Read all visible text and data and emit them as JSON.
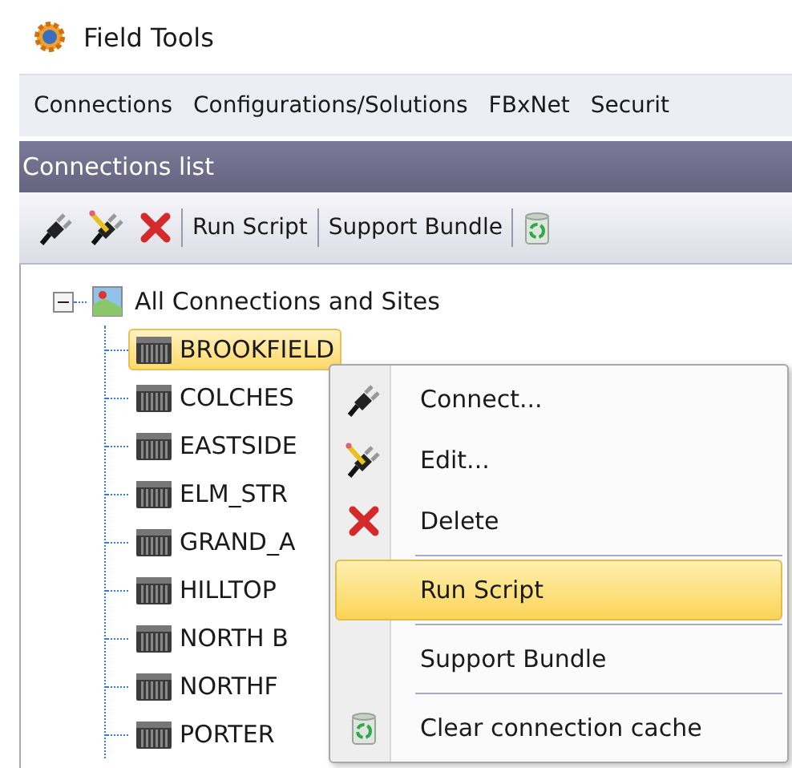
{
  "window": {
    "title": "Field Tools"
  },
  "menu_bar": [
    "Connections",
    "Configurations/Solutions",
    "FBxNet",
    "Securit"
  ],
  "panel": {
    "title": "Connections list"
  },
  "toolbar": {
    "text_buttons": [
      "Run Script",
      "Support Bundle"
    ]
  },
  "tree": {
    "label": "All Connections and Sites",
    "expanded": true,
    "children": [
      {
        "label": "BROOKFIELD",
        "selected": true
      },
      {
        "label": "COLCHES",
        "selected": false
      },
      {
        "label": "EASTSIDE",
        "selected": false
      },
      {
        "label": "ELM_STR",
        "selected": false
      },
      {
        "label": "GRAND_A",
        "selected": false
      },
      {
        "label": "HILLTOP",
        "selected": false
      },
      {
        "label": "NORTH B",
        "selected": false
      },
      {
        "label": "NORTHF",
        "selected": false
      },
      {
        "label": "PORTER",
        "selected": false
      }
    ]
  },
  "context_menu": [
    {
      "label": "Connect...",
      "selected": false,
      "separator_above": false
    },
    {
      "label": "Edit...",
      "selected": false,
      "separator_above": false
    },
    {
      "label": "Delete",
      "selected": false,
      "separator_above": false
    },
    {
      "label": "Run Script",
      "selected": true,
      "separator_above": true
    },
    {
      "label": "Support Bundle",
      "selected": false,
      "separator_above": true
    },
    {
      "label": "Clear connection cache",
      "selected": false,
      "separator_above": true
    }
  ]
}
